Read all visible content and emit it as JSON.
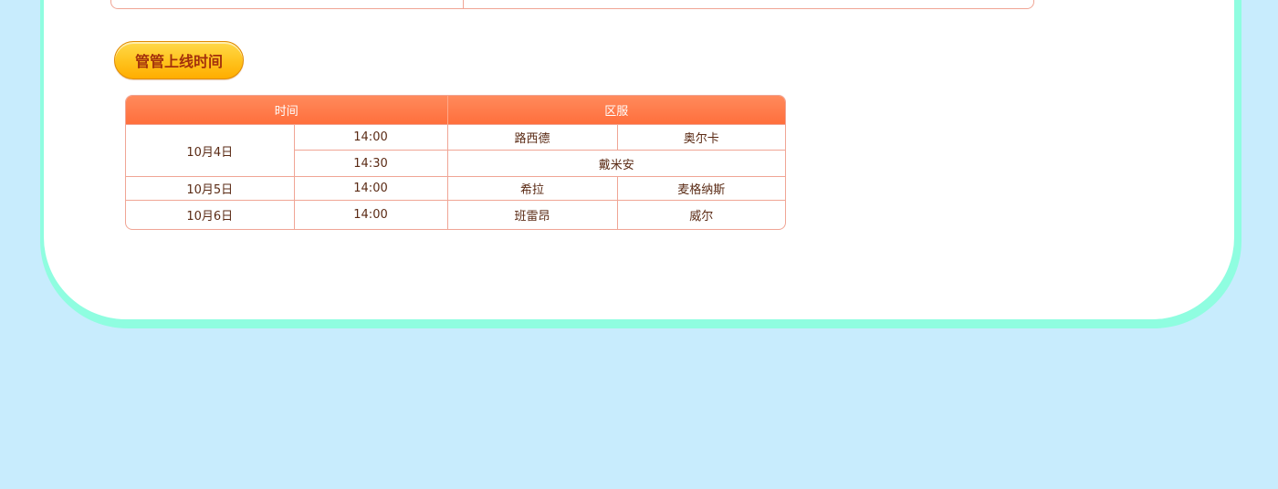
{
  "section": {
    "title": "管管上线时间"
  },
  "schedule": {
    "headers": {
      "time": "时间",
      "server": "区服"
    },
    "rows": [
      {
        "date": "10月4日",
        "time": "14:00",
        "servers": [
          "路西德",
          "奥尔卡"
        ]
      },
      {
        "date": "10月4日",
        "time": "14:30",
        "servers": [
          "戴米安"
        ]
      },
      {
        "date": "10月5日",
        "time": "14:00",
        "servers": [
          "希拉",
          "麦格纳斯"
        ]
      },
      {
        "date": "10月6日",
        "time": "14:00",
        "servers": [
          "班雷昂",
          "威尔"
        ]
      }
    ]
  },
  "colors": {
    "page_bg": "#c8ecfd",
    "card_border": "#8ffde0",
    "header_orange": "#ff7548",
    "table_border": "#f0a595",
    "pill_yellow": "#ffc21c",
    "pill_text": "#a3300c",
    "cell_text": "#5a2a14"
  }
}
